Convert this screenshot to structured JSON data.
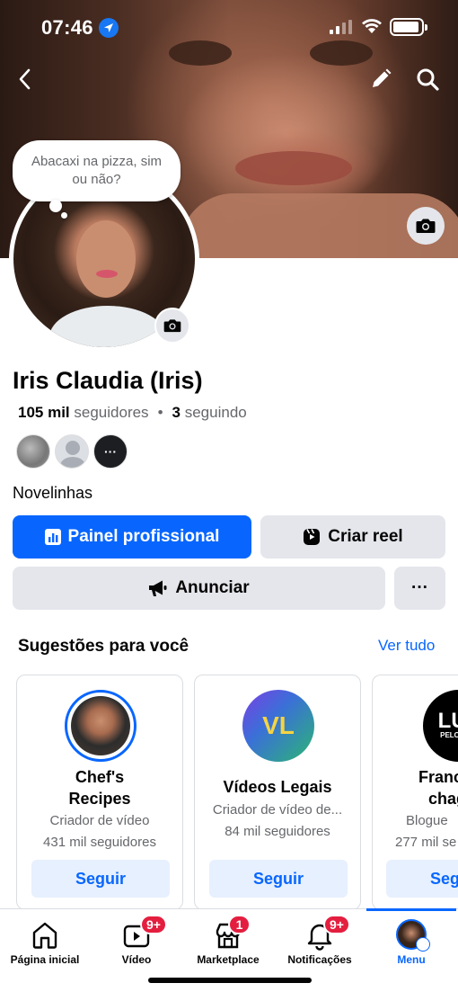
{
  "status_bar": {
    "time": "07:46"
  },
  "profile": {
    "bubble_note": "Abacaxi na pizza, sim ou não?",
    "name": "Iris Claudia (Iris)",
    "followers_count": "105 mil",
    "followers_label": "seguidores",
    "separator": "•",
    "following_count": "3",
    "following_label": "seguindo",
    "more_friends_glyph": "···",
    "bio": "Novelinhas"
  },
  "actions": {
    "professional_panel": "Painel profissional",
    "create_reel": "Criar reel",
    "advertise": "Anunciar",
    "more_glyph": "···"
  },
  "suggestions": {
    "title": "Sugestões para você",
    "see_all": "Ver tudo",
    "cards": [
      {
        "name_line1": "Chef's",
        "name_line2": "Recipes",
        "category": "Criador de vídeo",
        "followers": "431 mil seguidores",
        "button": "Seguir"
      },
      {
        "name": "Vídeos Legais",
        "avatar_text": "VL",
        "category": "Criador de vídeo de...",
        "followers": "84 mil seguidores",
        "button": "Seguir"
      },
      {
        "name_line1": "Franc",
        "name_line2": "chag",
        "avatar_text": "LUT",
        "avatar_subtext": "PELO MEU",
        "category": "Blogue",
        "followers": "277 mil se",
        "button": "Seg"
      }
    ]
  },
  "tabbar": {
    "tabs": [
      {
        "label": "Página inicial",
        "icon": "home-icon"
      },
      {
        "label": "Vídeo",
        "icon": "video-icon",
        "badge": "9+"
      },
      {
        "label": "Marketplace",
        "icon": "marketplace-icon",
        "badge": "1"
      },
      {
        "label": "Notificações",
        "icon": "bell-icon",
        "badge": "9+"
      },
      {
        "label": "Menu",
        "icon": "menu-avatar"
      }
    ],
    "active": "Menu"
  },
  "colors": {
    "accent": "#0866ff",
    "badge": "#e41e3f",
    "button_gray": "#e4e6eb",
    "secondary_text": "#65676b"
  }
}
